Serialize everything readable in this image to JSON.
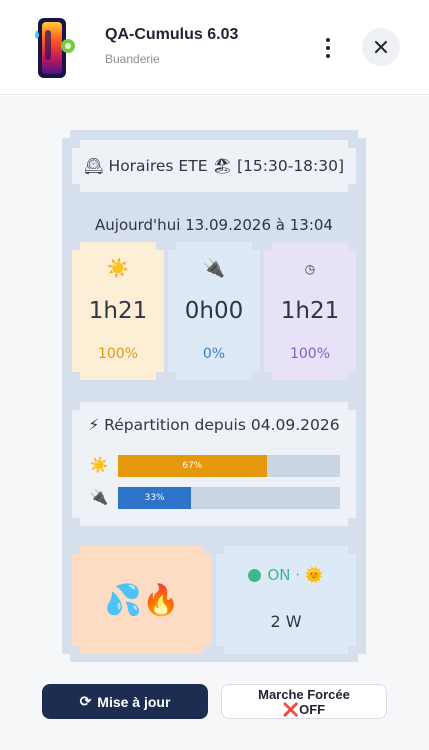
{
  "header": {
    "title": "QA-Cumulus 6.03",
    "subtitle": "Buanderie"
  },
  "schedule": {
    "label": "🕰 Horaires ETE 🏖 [15:30-18:30]"
  },
  "today": {
    "label": "Aujourd'hui 13.09.2026 à 13:04"
  },
  "tiles": [
    {
      "icon": "☀️",
      "icon_name": "sun-icon",
      "time": "1h21",
      "percent": "100%",
      "bg": "#fdeed6",
      "accent": "#e09a12"
    },
    {
      "icon": "🔌",
      "icon_name": "plug-icon",
      "time": "0h00",
      "percent": "0%",
      "bg": "#dde9f6",
      "accent": "#3b82c4"
    },
    {
      "icon": "◷",
      "icon_name": "clock-icon",
      "time": "1h21",
      "percent": "100%",
      "bg": "#e7e2f7",
      "accent": "#7c62c7"
    }
  ],
  "repartition": {
    "title": "⚡ Répartition depuis 04.09.2026",
    "rows": [
      {
        "icon": "☀️",
        "icon_name": "sun-icon",
        "label": "67%",
        "value": 0.67,
        "color": "#e6980c"
      },
      {
        "icon": "🔌",
        "icon_name": "plug-icon",
        "label": "33%",
        "value": 0.33,
        "color": "#2d74c8"
      }
    ]
  },
  "heater": {
    "emoji": "💦🔥",
    "icon_name": "water-fire-icon"
  },
  "status": {
    "state": "ON · 🌞",
    "power": "2 W",
    "color": "#3bb88e"
  },
  "buttons": {
    "update_icon": "⟳",
    "update_label": "Mise à jour",
    "force_line1": "Marche Forcée",
    "force_line2": "❌OFF"
  }
}
